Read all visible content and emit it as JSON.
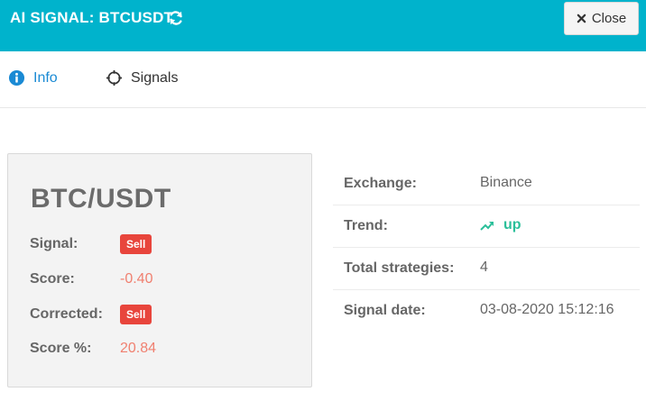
{
  "header": {
    "title": "AI SIGNAL: BTCUSDT",
    "refresh_icon": "refresh-icon",
    "close_label": "Close",
    "background_color": "#00b3cc"
  },
  "tabs": [
    {
      "label": "Info",
      "icon": "info-circle-icon",
      "active": true
    },
    {
      "label": "Signals",
      "icon": "crosshair-icon",
      "active": false
    }
  ],
  "summary": {
    "pair": "BTC/USDT",
    "signal_label": "Signal:",
    "signal_value": "Sell",
    "score_label": "Score:",
    "score_value": "-0.40",
    "corrected_label": "Corrected:",
    "corrected_value": "Sell",
    "score_pct_label": "Score %:",
    "score_pct_value": "20.84"
  },
  "details": {
    "exchange_label": "Exchange:",
    "exchange_value": "Binance",
    "trend_label": "Trend:",
    "trend_value": "up",
    "trend_icon": "trend-up-icon",
    "strategies_label": "Total strategies:",
    "strategies_value": "4",
    "date_label": "Signal date:",
    "date_value": "03-08-2020 15:12:16"
  },
  "colors": {
    "accent": "#00b3cc",
    "sell_badge": "#e8453c",
    "negative_text": "#f08070",
    "trend_up": "#2bbf9a",
    "active_tab": "#1a8ad4"
  }
}
